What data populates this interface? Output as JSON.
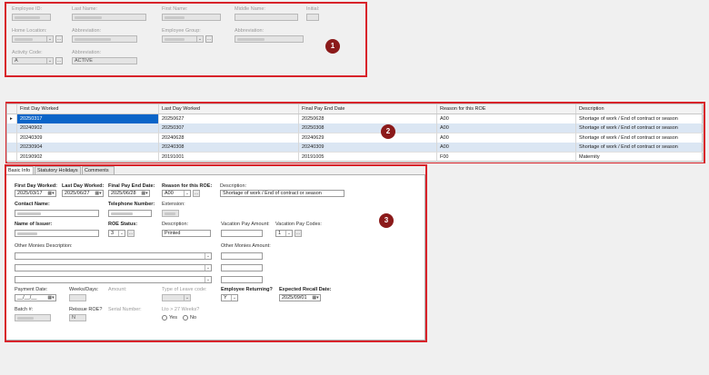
{
  "top_form": {
    "employee_id_label": "Employee ID:",
    "last_name_label": "Last Name:",
    "first_name_label": "First Name:",
    "middle_name_label": "Middle Name:",
    "initial_label": "Initial:",
    "home_location_label": "Home Location:",
    "abbreviation_label_1": "Abbreviation:",
    "employee_group_label": "Employee Group:",
    "abbreviation_label_2": "Abbreviation:",
    "activity_code_label": "Activity Code:",
    "activity_code_value": "A",
    "abbreviation_label_3": "Abbreviation:",
    "activity_abbreviation_value": "ACTIVE"
  },
  "grid": {
    "columns": [
      "First Day Worked",
      "Last Day Worked",
      "Final Pay End Date",
      "Reason for this ROE",
      "Description"
    ],
    "row_indicator": "▸",
    "rows": [
      [
        "20250317",
        "20250627",
        "20250628",
        "A00",
        "Shortage of work / End of contract or season"
      ],
      [
        "20240902",
        "20250307",
        "20250308",
        "A00",
        "Shortage of work / End of contract or season"
      ],
      [
        "20240309",
        "20240628",
        "20240629",
        "A00",
        "Shortage of work / End of contract or season"
      ],
      [
        "20230904",
        "20240308",
        "20240309",
        "A00",
        "Shortage of work / End of contract or season"
      ],
      [
        "20190902",
        "20191001",
        "20191005",
        "F00",
        "Maternity"
      ]
    ]
  },
  "tabs": [
    "Basic Info",
    "Statutory Holidays",
    "Comments"
  ],
  "basic": {
    "first_day_label": "First Day Worked:",
    "first_day_value": "2025/03/17",
    "last_day_label": "Last Day Worked:",
    "last_day_value": "2025/06/27",
    "final_pay_label": "Final Pay End Date:",
    "final_pay_value": "2025/06/28",
    "reason_label": "Reason for this ROE:",
    "reason_value": "A00",
    "description_label": "Description:",
    "description_value": "Shortage of work / End of contract or season",
    "contact_name_label": "Contact Name:",
    "telephone_label": "Telephone Number:",
    "extension_label": "Extension:",
    "issuer_label": "Name of Issuer:",
    "roe_status_label": "ROE Status:",
    "roe_status_value": "3",
    "status_description_label": "Description:",
    "status_description_value": "Printed",
    "vacation_amount_label": "Vacation Pay Amount:",
    "vacation_codes_label": "Vacation Pay Codes:",
    "vacation_codes_value": "1",
    "other_monies_label": "Other Monies Description:",
    "other_monies_amount_label": "Other Monies Amount:",
    "payment_date_label": "Payment Date:",
    "payment_date_value": "__/__/__",
    "weeks_days_label": "Weeks/Days:",
    "amount_label": "Amount:",
    "leave_code_label": "Type of Leave code:",
    "returning_label": "Employee Returning?",
    "returning_value": "Y",
    "recall_label": "Expected Recall Date:",
    "recall_value": "2025/09/01",
    "batch_label": "Batch #:",
    "reissue_label": "Reissue ROE?",
    "reissue_value": "N",
    "serial_label": "Serial Number:",
    "lto_label": "Lto > 27 Weeks?",
    "yes_label": "Yes",
    "no_label": "No"
  },
  "badges": [
    "1",
    "2",
    "3"
  ],
  "colors": {
    "highlight": "#d8232a",
    "badge": "#8b1a1a",
    "selection": "#0a64c8",
    "alt_row": "#dbe6f3"
  }
}
